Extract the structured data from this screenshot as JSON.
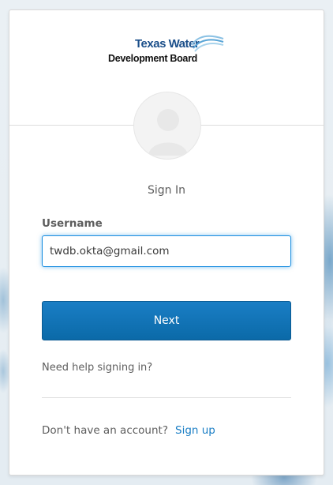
{
  "logo": {
    "line1": "Texas Water",
    "line2": "Development Board"
  },
  "form": {
    "title": "Sign In",
    "username_label": "Username",
    "username_value": "twdb.okta@gmail.com",
    "next_label": "Next",
    "help_link": "Need help signing in?",
    "signup_prompt": "Don't have an account?",
    "signup_link": "Sign up"
  },
  "icons": {
    "avatar": "user-silhouette-icon",
    "logo_wave": "water-wave-icon"
  },
  "colors": {
    "primary": "#1a7ec5",
    "focus_border": "#1a8ee0",
    "text": "#5e5e5e",
    "logo_blue": "#1b4f8a"
  }
}
